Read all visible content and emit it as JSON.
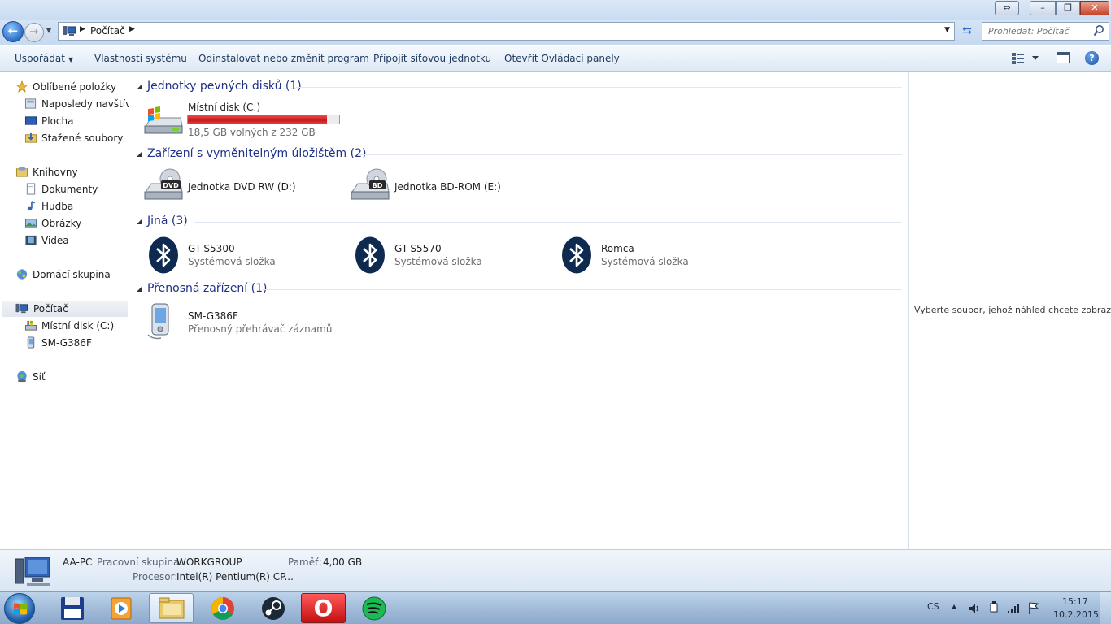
{
  "window": {
    "address_crumb": "Počítač",
    "search_placeholder": "Prohledat: Počítač",
    "caption_minimize": "–",
    "caption_maximize": "❐",
    "caption_close": "✕"
  },
  "commands": {
    "organize": "Uspořádat",
    "system_properties": "Vlastnosti systému",
    "uninstall": "Odinstalovat nebo změnit program",
    "map_drive": "Připojit síťovou jednotku",
    "control_panel": "Otevřít Ovládací panely"
  },
  "nav": {
    "favorites": "Oblíbené položky",
    "recent": "Naposledy navštívené",
    "desktop": "Plocha",
    "downloads": "Stažené soubory",
    "libraries": "Knihovny",
    "documents": "Dokumenty",
    "music": "Hudba",
    "pictures": "Obrázky",
    "videos": "Videa",
    "homegroup": "Domácí skupina",
    "computer": "Počítač",
    "local_disk": "Místní disk (C:)",
    "device": "SM-G386F",
    "network": "Síť"
  },
  "groups": {
    "hdd": {
      "title": "Jednotky pevných disků (1)",
      "items": [
        {
          "name": "Místní disk (C:)",
          "sub": "18,5 GB volných z 232 GB",
          "used_fraction": 0.92
        }
      ]
    },
    "removable": {
      "title": "Zařízení s vyměnitelným úložištěm (2)",
      "items": [
        {
          "name": "Jednotka DVD RW (D:)",
          "badge": "DVD"
        },
        {
          "name": "Jednotka BD-ROM (E:)",
          "badge": "BD"
        }
      ]
    },
    "other": {
      "title": "Jiná (3)",
      "items": [
        {
          "name": "GT-S5300",
          "sub": "Systémová složka"
        },
        {
          "name": "GT-S5570",
          "sub": "Systémová složka"
        },
        {
          "name": "Romca",
          "sub": "Systémová složka"
        }
      ]
    },
    "portable": {
      "title": "Přenosná zařízení (1)",
      "items": [
        {
          "name": "SM-G386F",
          "sub": "Přenosný přehrávač záznamů"
        }
      ]
    }
  },
  "preview": {
    "message": "Vyberte soubor, jehož náhled chcete zobrazit."
  },
  "details": {
    "name": "AA-PC",
    "workgroup_label": "Pracovní skupina:",
    "workgroup_value": "WORKGROUP",
    "memory_label": "Paměť:",
    "memory_value": "4,00 GB",
    "cpu_label": "Procesor:",
    "cpu_value": "Intel(R) Pentium(R) CP..."
  },
  "taskbar": {
    "lang": "CS",
    "time": "15:17",
    "date": "10.2.2015",
    "opera_glyph": "O"
  },
  "colors": {
    "group_title": "#1e3287",
    "disk_fill": "#d62020",
    "bluetooth": "#0f2a50"
  }
}
